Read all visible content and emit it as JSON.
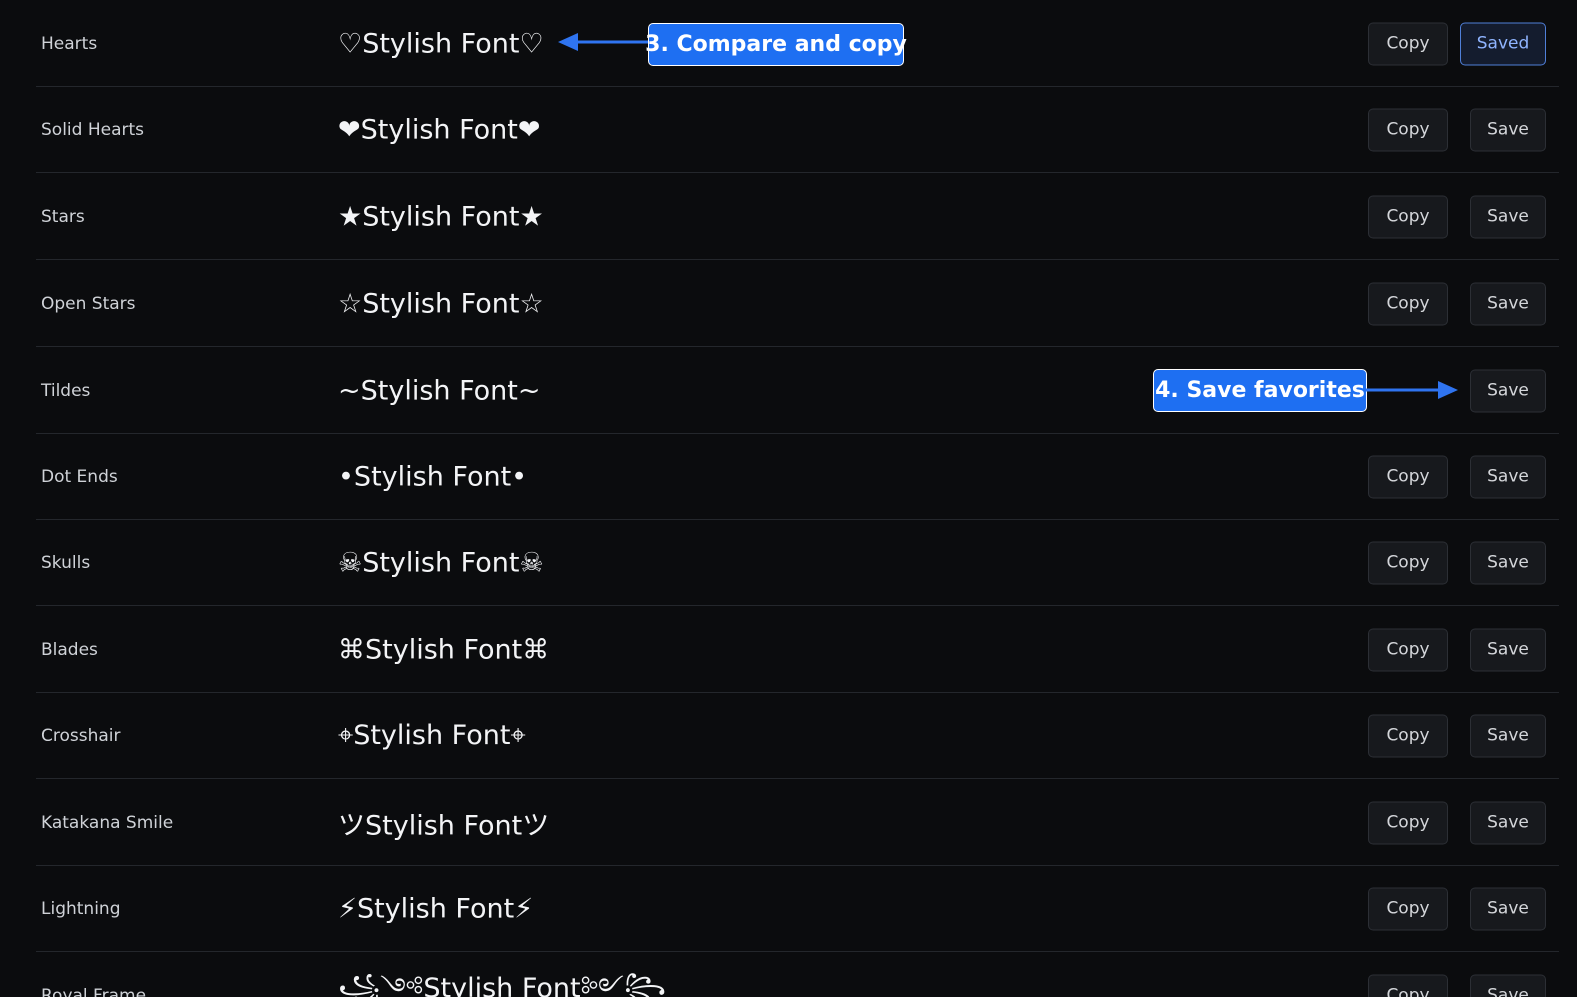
{
  "rows": [
    {
      "label": "Hearts",
      "preview": "♡Stylish Font♡",
      "copy_label": "Copy",
      "save_label": "Saved",
      "saved": true
    },
    {
      "label": "Solid Hearts",
      "preview": "❤Stylish Font❤",
      "copy_label": "Copy",
      "save_label": "Save",
      "saved": false
    },
    {
      "label": "Stars",
      "preview": "★Stylish Font★",
      "copy_label": "Copy",
      "save_label": "Save",
      "saved": false
    },
    {
      "label": "Open Stars",
      "preview": "☆Stylish Font☆",
      "copy_label": "Copy",
      "save_label": "Save",
      "saved": false
    },
    {
      "label": "Tildes",
      "preview": "~Stylish Font~",
      "copy_label": "",
      "save_label": "Save",
      "saved": false
    },
    {
      "label": "Dot Ends",
      "preview": "•Stylish Font•",
      "copy_label": "Copy",
      "save_label": "Save",
      "saved": false
    },
    {
      "label": "Skulls",
      "preview": "☠Stylish Font☠",
      "copy_label": "Copy",
      "save_label": "Save",
      "saved": false
    },
    {
      "label": "Blades",
      "preview": "⌘Stylish Font⌘",
      "copy_label": "Copy",
      "save_label": "Save",
      "saved": false
    },
    {
      "label": "Crosshair",
      "preview": "⌖Stylish Font⌖",
      "copy_label": "Copy",
      "save_label": "Save",
      "saved": false
    },
    {
      "label": "Katakana Smile",
      "preview": "ツStylish Fontツ",
      "copy_label": "Copy",
      "save_label": "Save",
      "saved": false
    },
    {
      "label": "Lightning",
      "preview": "⚡Stylish Font⚡",
      "copy_label": "Copy",
      "save_label": "Save",
      "saved": false
    },
    {
      "label": "Royal Frame",
      "preview": "꧁༺Stylish Font༻꧂",
      "copy_label": "Copy",
      "save_label": "Save",
      "saved": false
    }
  ],
  "callouts": {
    "compare": "3. Compare and copy",
    "save": "4. Save favorites"
  },
  "colors": {
    "background": "#0b0c0e",
    "button_bg": "#17191d",
    "saved_border": "#4f7fd8",
    "callout_blue": "#1e6ff2",
    "arrow_blue": "#2f74f0"
  },
  "icons": [
    "arrow-left-icon",
    "arrow-right-icon"
  ]
}
